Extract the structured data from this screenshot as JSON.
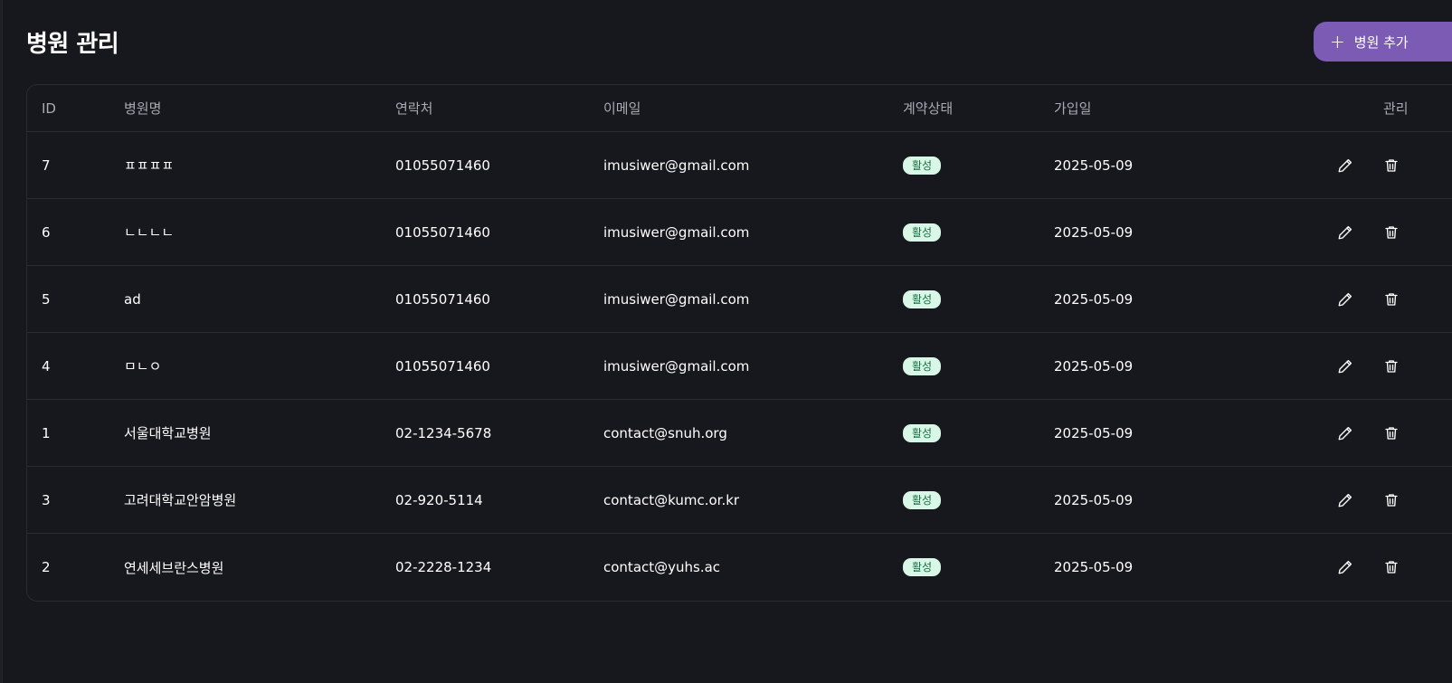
{
  "page": {
    "title": "병원 관리",
    "add_button_label": "병원 추가"
  },
  "table": {
    "headers": {
      "id": "ID",
      "name": "병원명",
      "phone": "연락처",
      "email": "이메일",
      "status": "계약상태",
      "joined": "가입일",
      "manage": "관리"
    },
    "rows": [
      {
        "id": "7",
        "name": "ㅍㅍㅍㅍ",
        "phone": "01055071460",
        "email": "imusiwer@gmail.com",
        "status": "활성",
        "joined": "2025-05-09"
      },
      {
        "id": "6",
        "name": "ㄴㄴㄴㄴ",
        "phone": "01055071460",
        "email": "imusiwer@gmail.com",
        "status": "활성",
        "joined": "2025-05-09"
      },
      {
        "id": "5",
        "name": "ad",
        "phone": "01055071460",
        "email": "imusiwer@gmail.com",
        "status": "활성",
        "joined": "2025-05-09"
      },
      {
        "id": "4",
        "name": "ㅁㄴㅇ",
        "phone": "01055071460",
        "email": "imusiwer@gmail.com",
        "status": "활성",
        "joined": "2025-05-09"
      },
      {
        "id": "1",
        "name": "서울대학교병원",
        "phone": "02-1234-5678",
        "email": "contact@snuh.org",
        "status": "활성",
        "joined": "2025-05-09"
      },
      {
        "id": "3",
        "name": "고려대학교안암병원",
        "phone": "02-920-5114",
        "email": "contact@kumc.or.kr",
        "status": "활성",
        "joined": "2025-05-09"
      },
      {
        "id": "2",
        "name": "연세세브란스병원",
        "phone": "02-2228-1234",
        "email": "contact@yuhs.ac",
        "status": "활성",
        "joined": "2025-05-09"
      }
    ]
  },
  "colors": {
    "background": "#17181d",
    "accent": "#7c5bb5",
    "badge_bg": "#d9f7e6",
    "badge_text": "#1c6b42"
  },
  "icons": {
    "add": "plus-icon",
    "edit": "pencil-icon",
    "delete": "trash-icon"
  }
}
